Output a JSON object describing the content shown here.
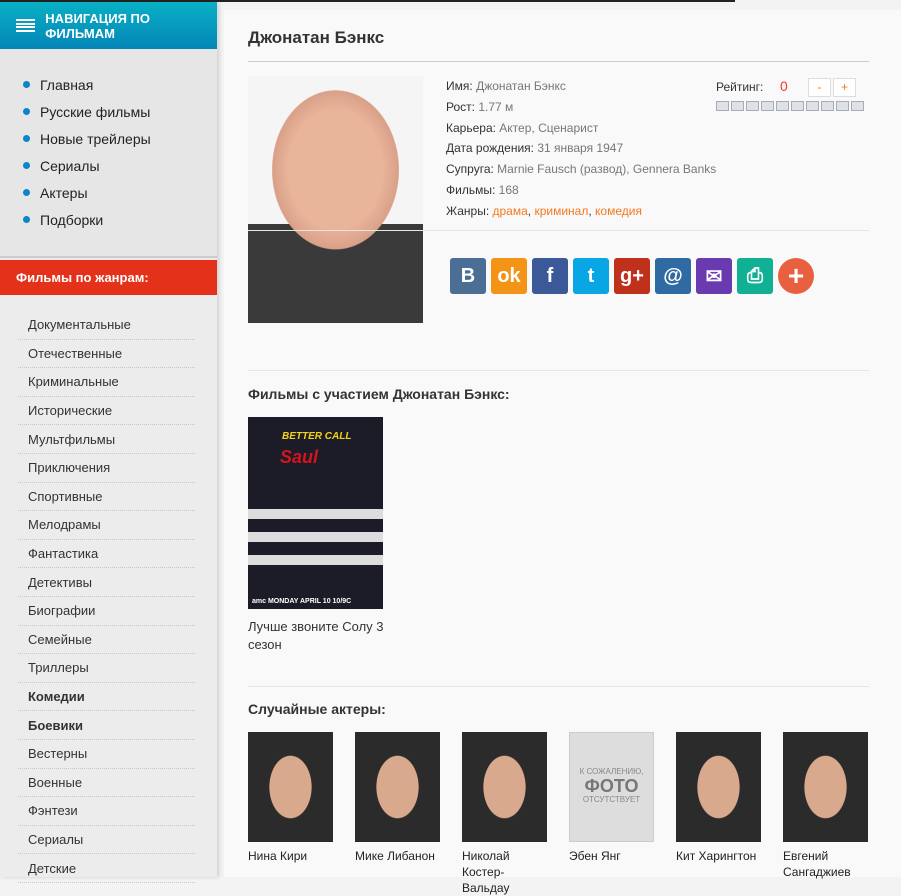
{
  "sidebar": {
    "nav_title": "НАВИГАЦИЯ ПО ФИЛЬМАМ",
    "nav_items": [
      "Главная",
      "Русские фильмы",
      "Новые трейлеры",
      "Сериалы",
      "Актеры",
      "Подборки"
    ],
    "genres_title": "Фильмы по жанрам:",
    "genres": [
      "Документальные",
      "Отечественные",
      "Криминальные",
      "Исторические",
      "Мультфильмы",
      "Приключения",
      "Спортивные",
      "Мелодрамы",
      "Фантастика",
      "Детективы",
      "Биографии",
      "Семейные",
      "Триллеры",
      "Комедии",
      "Боевики",
      "Вестерны",
      "Военные",
      "Фэнтези",
      "Сериалы",
      "Детские"
    ]
  },
  "actor": {
    "title": "Джонатан Бэнкс",
    "fields": [
      {
        "label": "Имя:",
        "value": "Джонатан Бэнкс"
      },
      {
        "label": "Рост:",
        "value": "1.77 м"
      },
      {
        "label": "Карьера:",
        "value": "Актер, Сценарист"
      },
      {
        "label": "Дата рождения:",
        "value": "31 января 1947"
      },
      {
        "label": "Супруга:",
        "value": "Marnie Fausch (развод), Gennera Banks"
      },
      {
        "label": "Фильмы:",
        "value": "168"
      }
    ],
    "genres_label": "Жанры:",
    "genres": [
      "драма",
      "криминал",
      "комедия"
    ],
    "rating": {
      "label": "Рейтинг:",
      "value": "0",
      "minus": "-",
      "plus": "+",
      "stars_total": 10,
      "stars_filled": 0
    }
  },
  "social": [
    {
      "name": "vk",
      "glyph": "B",
      "color": "#4a6e94"
    },
    {
      "name": "odnoklassniki",
      "glyph": "ok",
      "color": "#f39416"
    },
    {
      "name": "facebook",
      "glyph": "f",
      "color": "#3b5998"
    },
    {
      "name": "twitter",
      "glyph": "t",
      "color": "#09a6e6"
    },
    {
      "name": "google-plus",
      "glyph": "g+",
      "color": "#c0311b"
    },
    {
      "name": "mail-ru",
      "glyph": "@",
      "color": "#2f6aa3"
    },
    {
      "name": "email",
      "glyph": "✉",
      "color": "#6a3bb0"
    },
    {
      "name": "print",
      "glyph": "⎙",
      "color": "#10b094"
    },
    {
      "name": "more",
      "glyph": "+",
      "color": "#e8603f"
    }
  ],
  "films": {
    "heading": "Фильмы с участием Джонатан Бэнкс:",
    "items": [
      {
        "title": "Лучше звоните Солу 3 сезон",
        "poster": {
          "line1": "BETTER CALL",
          "line2": "Saul",
          "footer": "amc MONDAY APRIL 10 10/9C"
        }
      }
    ]
  },
  "random": {
    "heading": "Случайные актеры:",
    "nophoto": {
      "line1": "К СОЖАЛЕНИЮ,",
      "line2": "ФОТО",
      "line3": "ОТСУТСТВУЕТ"
    },
    "actors": [
      "Нина Кири",
      "Мике Либанон",
      "Николай Костер-Вальдау",
      "Эбен Янг",
      "Кит Харингтон",
      "Евгений Сангаджиев"
    ]
  }
}
